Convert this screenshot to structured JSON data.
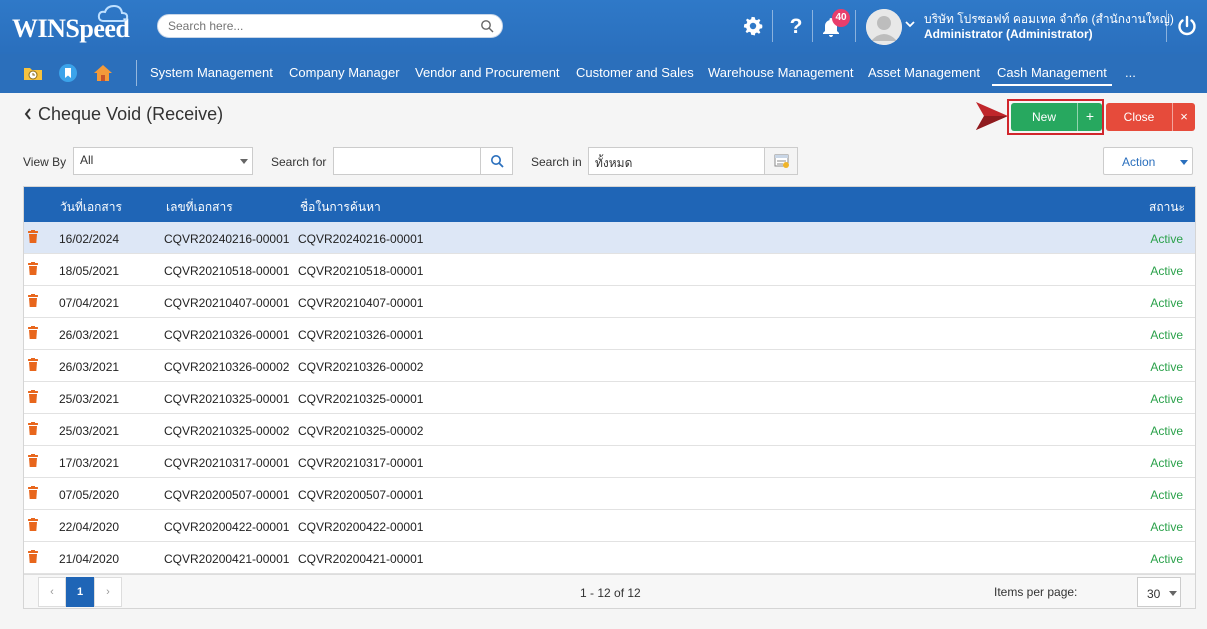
{
  "app": {
    "logo_text": "WINSpeed",
    "search_placeholder": "Search here...",
    "notification_count": "40",
    "user_company": "บริษัท โปรซอฟท์ คอมเทค จำกัด (สำนักงานใหญ่)",
    "user_role": "Administrator (Administrator)"
  },
  "nav": {
    "items": [
      {
        "label": "System Management"
      },
      {
        "label": "Company Manager"
      },
      {
        "label": "Vendor and Procurement"
      },
      {
        "label": "Customer and Sales"
      },
      {
        "label": "Warehouse Management"
      },
      {
        "label": "Asset Management"
      },
      {
        "label": "Cash Management"
      },
      {
        "label": "..."
      }
    ],
    "active": "Cash Management"
  },
  "page": {
    "title": "Cheque Void (Receive)",
    "new_label": "New",
    "new_plus": "+",
    "close_label": "Close",
    "close_x": "×"
  },
  "filters": {
    "view_by_label": "View By",
    "view_by_value": "All",
    "search_for_label": "Search for",
    "search_for_value": "",
    "search_in_label": "Search in",
    "search_in_value": "ทั้งหมด",
    "action_label": "Action"
  },
  "grid": {
    "columns": [
      "วันที่เอกสาร",
      "เลขที่เอกสาร",
      "ชื่อในการค้นหา",
      "สถานะ"
    ],
    "rows": [
      {
        "date": "16/02/2024",
        "doc_no": "CQVR20240216-00001",
        "search_name": "CQVR20240216-00001",
        "status": "Active"
      },
      {
        "date": "18/05/2021",
        "doc_no": "CQVR20210518-00001",
        "search_name": "CQVR20210518-00001",
        "status": "Active"
      },
      {
        "date": "07/04/2021",
        "doc_no": "CQVR20210407-00001",
        "search_name": "CQVR20210407-00001",
        "status": "Active"
      },
      {
        "date": "26/03/2021",
        "doc_no": "CQVR20210326-00001",
        "search_name": "CQVR20210326-00001",
        "status": "Active"
      },
      {
        "date": "26/03/2021",
        "doc_no": "CQVR20210326-00002",
        "search_name": "CQVR20210326-00002",
        "status": "Active"
      },
      {
        "date": "25/03/2021",
        "doc_no": "CQVR20210325-00001",
        "search_name": "CQVR20210325-00001",
        "status": "Active"
      },
      {
        "date": "25/03/2021",
        "doc_no": "CQVR20210325-00002",
        "search_name": "CQVR20210325-00002",
        "status": "Active"
      },
      {
        "date": "17/03/2021",
        "doc_no": "CQVR20210317-00001",
        "search_name": "CQVR20210317-00001",
        "status": "Active"
      },
      {
        "date": "07/05/2020",
        "doc_no": "CQVR20200507-00001",
        "search_name": "CQVR20200507-00001",
        "status": "Active"
      },
      {
        "date": "22/04/2020",
        "doc_no": "CQVR20200422-00001",
        "search_name": "CQVR20200422-00001",
        "status": "Active"
      },
      {
        "date": "21/04/2020",
        "doc_no": "CQVR20200421-00001",
        "search_name": "CQVR20200421-00001",
        "status": "Active"
      }
    ],
    "selected_row": 0
  },
  "pager": {
    "prev": "‹",
    "current_page": "1",
    "next": "›",
    "info": "1 - 12 of 12",
    "items_per_page_label": "Items per page:",
    "items_per_page": "30"
  },
  "colors": {
    "header_blue": "#2b6fbb",
    "grid_head": "#1f65b6",
    "new_green": "#27a85f",
    "close_red": "#e64b3b",
    "status_green": "#2aa14a",
    "trash_orange": "#e8661c",
    "badge_pink": "#e83e6c"
  },
  "icons": {
    "top": [
      "gear-icon",
      "help-icon",
      "bell-icon",
      "power-icon"
    ],
    "nav": [
      "folder-clock-icon",
      "bookmark-icon",
      "home-icon"
    ],
    "row": "trash-icon"
  }
}
